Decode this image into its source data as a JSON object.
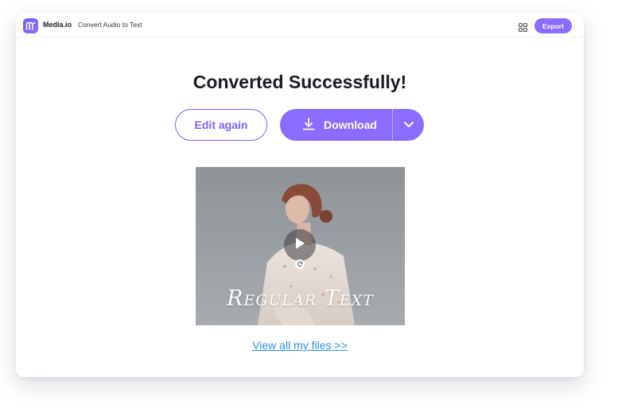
{
  "header": {
    "brand": "Media.io",
    "tool_name": "Convert Audio to Text",
    "export_label": "Export"
  },
  "main": {
    "title": "Converted Successfully!",
    "edit_again_label": "Edit again",
    "download_label": "Download",
    "preview_text": "Regular Text",
    "view_files_label": "View all my files >>"
  },
  "colors": {
    "accent": "#8a6cff",
    "link": "#2f8fe6",
    "title": "#1a1a22"
  },
  "icons": [
    "media-io-logo-icon",
    "apps-grid-icon",
    "download-icon",
    "chevron-down-icon",
    "play-icon",
    "refresh-icon"
  ]
}
